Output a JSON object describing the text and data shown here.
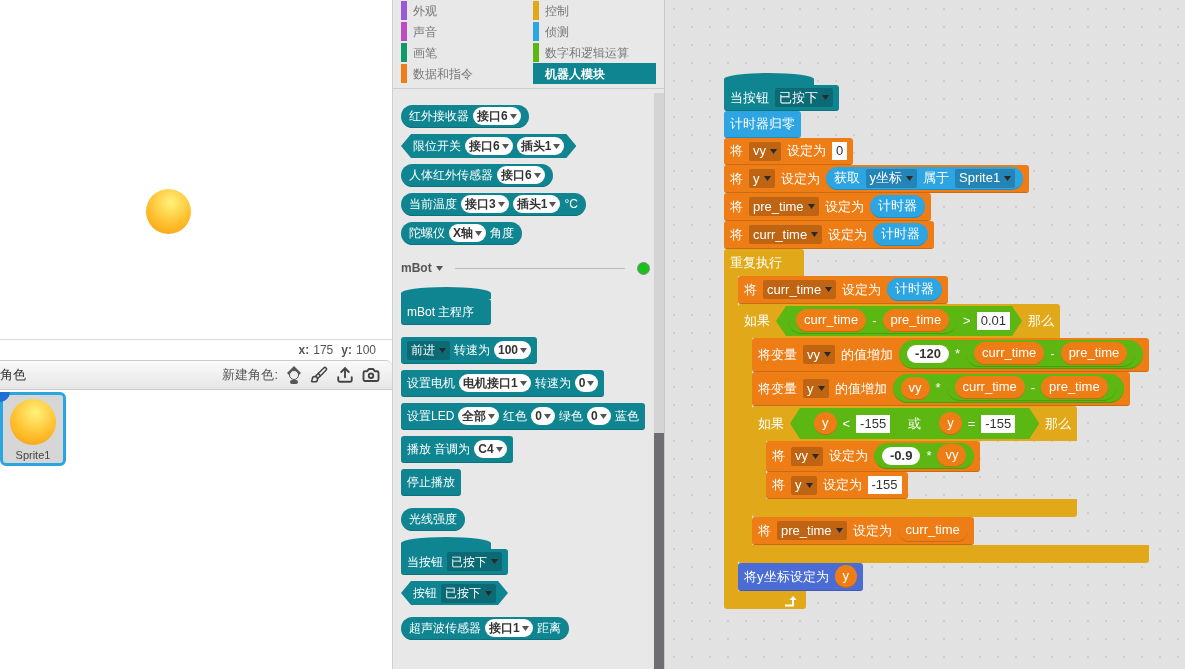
{
  "stage": {
    "x_label": "x:",
    "x_value": "175",
    "y_label": "y:",
    "y_value": "100"
  },
  "sprites": {
    "title": "角色",
    "new_label": "新建角色:",
    "items": [
      {
        "name": "Sprite1",
        "selected": true
      }
    ]
  },
  "palette": {
    "categories": [
      {
        "label": "外观",
        "color": "#9a5ad8",
        "selected": false
      },
      {
        "label": "控制",
        "color": "#e1a91a",
        "selected": false
      },
      {
        "label": "声音",
        "color": "#c04ac4",
        "selected": false
      },
      {
        "label": "侦测",
        "color": "#2ca5e2",
        "selected": false
      },
      {
        "label": "画笔",
        "color": "#0e9a6c",
        "selected": false
      },
      {
        "label": "数字和逻辑运算",
        "color": "#5cb712",
        "selected": false
      },
      {
        "label": "数据和指令",
        "color": "#ee7d16",
        "selected": false
      },
      {
        "label": "机器人模块",
        "color": "#0f8591",
        "selected": true
      }
    ],
    "blocks_top": [
      {
        "color": "#0f8591",
        "kind": "reporter",
        "parts": [
          {
            "kind": "label",
            "text": "红外接收器"
          },
          {
            "kind": "pill",
            "text": "接口6"
          }
        ]
      },
      {
        "color": "#0f8591",
        "kind": "boolean",
        "parts": [
          {
            "kind": "label",
            "text": "限位开关"
          },
          {
            "kind": "pill",
            "text": "接口6"
          },
          {
            "kind": "pill",
            "text": "插头1"
          }
        ]
      },
      {
        "color": "#0f8591",
        "kind": "reporter",
        "parts": [
          {
            "kind": "label",
            "text": "人体红外传感器"
          },
          {
            "kind": "pill",
            "text": "接口6"
          }
        ]
      },
      {
        "color": "#0f8591",
        "kind": "reporter",
        "parts": [
          {
            "kind": "label",
            "text": "当前温度"
          },
          {
            "kind": "pill",
            "text": "接口3"
          },
          {
            "kind": "pill",
            "text": "插头1"
          },
          {
            "kind": "label",
            "text": "°C"
          }
        ]
      },
      {
        "color": "#0f8591",
        "kind": "reporter",
        "parts": [
          {
            "kind": "label",
            "text": "陀螺仪"
          },
          {
            "kind": "pill",
            "text": "X轴"
          },
          {
            "kind": "label",
            "text": "角度"
          }
        ]
      }
    ],
    "section": {
      "title": "mBot",
      "connected": true
    },
    "groups": [
      [
        {
          "color": "#0f8591",
          "kind": "hat",
          "parts": [
            {
              "kind": "label",
              "text": "mBot 主程序"
            }
          ]
        }
      ],
      [
        {
          "color": "#0f8591",
          "kind": "stack",
          "parts": [
            {
              "kind": "menu",
              "text": "前进"
            },
            {
              "kind": "label",
              "text": "转速为"
            },
            {
              "kind": "pill",
              "text": "100"
            }
          ]
        },
        {
          "color": "#0f8591",
          "kind": "stack",
          "parts": [
            {
              "kind": "label",
              "text": "设置电机"
            },
            {
              "kind": "pill",
              "text": "电机接口1"
            },
            {
              "kind": "label",
              "text": "转速为"
            },
            {
              "kind": "pill",
              "text": "0"
            }
          ]
        },
        {
          "color": "#0f8591",
          "kind": "stack",
          "parts": [
            {
              "kind": "label",
              "text": "设置LED"
            },
            {
              "kind": "pill",
              "text": "全部"
            },
            {
              "kind": "label",
              "text": "红色"
            },
            {
              "kind": "pill",
              "text": "0"
            },
            {
              "kind": "label",
              "text": "绿色"
            },
            {
              "kind": "pill",
              "text": "0"
            },
            {
              "kind": "label",
              "text": "蓝色"
            }
          ]
        },
        {
          "color": "#0f8591",
          "kind": "stack",
          "parts": [
            {
              "kind": "label",
              "text": "播放 音调为"
            },
            {
              "kind": "pill",
              "text": "C4"
            }
          ]
        },
        {
          "color": "#0f8591",
          "kind": "stack",
          "parts": [
            {
              "kind": "label",
              "text": "停止播放"
            }
          ]
        }
      ],
      [
        {
          "color": "#0f8591",
          "kind": "reporter",
          "parts": [
            {
              "kind": "label",
              "text": "光线强度"
            }
          ]
        },
        {
          "color": "#0f8591",
          "kind": "hat",
          "parts": [
            {
              "kind": "label",
              "text": "当按钮"
            },
            {
              "kind": "menu",
              "text": "已按下"
            }
          ]
        },
        {
          "color": "#0f8591",
          "kind": "boolean",
          "parts": [
            {
              "kind": "label",
              "text": "按钮"
            },
            {
              "kind": "menu",
              "text": "已按下"
            }
          ]
        }
      ],
      [
        {
          "color": "#0f8591",
          "kind": "reporter",
          "parts": [
            {
              "kind": "label",
              "text": "超声波传感器"
            },
            {
              "kind": "pill",
              "text": "接口1"
            },
            {
              "kind": "label",
              "text": "距离"
            }
          ]
        }
      ]
    ]
  },
  "script": {
    "blocks": [
      {
        "color": "#0f8591",
        "kind": "hat",
        "parts": [
          {
            "kind": "label",
            "text": "当按钮"
          },
          {
            "kind": "menu",
            "text": "已按下"
          }
        ]
      },
      {
        "color": "#2ca5e2",
        "kind": "stack",
        "parts": [
          {
            "kind": "label",
            "text": "计时器归零"
          }
        ]
      },
      {
        "color": "#ee7d16",
        "kind": "stack",
        "parts": [
          {
            "kind": "label",
            "text": "将"
          },
          {
            "kind": "menu",
            "text": "vy"
          },
          {
            "kind": "label",
            "text": "设定为"
          },
          {
            "kind": "number",
            "text": "0"
          }
        ]
      },
      {
        "color": "#ee7d16",
        "kind": "stack",
        "parts": [
          {
            "kind": "label",
            "text": "将"
          },
          {
            "kind": "menu",
            "text": "y"
          },
          {
            "kind": "label",
            "text": "设定为"
          },
          {
            "kind": "block",
            "block": {
              "color": "#2ca5e2",
              "kind": "reporter",
              "parts": [
                {
                  "kind": "label",
                  "text": "获取"
                },
                {
                  "kind": "menu",
                  "text": "y坐标"
                },
                {
                  "kind": "label",
                  "text": "属于"
                },
                {
                  "kind": "menu",
                  "text": "Sprite1"
                }
              ]
            }
          }
        ]
      },
      {
        "color": "#ee7d16",
        "kind": "stack",
        "parts": [
          {
            "kind": "label",
            "text": "将"
          },
          {
            "kind": "menu",
            "text": "pre_time"
          },
          {
            "kind": "label",
            "text": "设定为"
          },
          {
            "kind": "block",
            "block": {
              "color": "#2ca5e2",
              "kind": "reporter",
              "parts": [
                {
                  "kind": "label",
                  "text": "计时器"
                }
              ]
            }
          }
        ]
      },
      {
        "color": "#ee7d16",
        "kind": "stack",
        "parts": [
          {
            "kind": "label",
            "text": "将"
          },
          {
            "kind": "menu",
            "text": "curr_time"
          },
          {
            "kind": "label",
            "text": "设定为"
          },
          {
            "kind": "block",
            "block": {
              "color": "#2ca5e2",
              "kind": "reporter",
              "parts": [
                {
                  "kind": "label",
                  "text": "计时器"
                }
              ]
            }
          }
        ]
      },
      {
        "color": "#e1a91a",
        "kind": "c",
        "loop": true,
        "parts": [
          {
            "kind": "label",
            "text": "重复执行"
          }
        ],
        "children": [
          {
            "color": "#ee7d16",
            "kind": "stack",
            "parts": [
              {
                "kind": "label",
                "text": "将"
              },
              {
                "kind": "menu",
                "text": "curr_time"
              },
              {
                "kind": "label",
                "text": "设定为"
              },
              {
                "kind": "block",
                "block": {
                  "color": "#2ca5e2",
                  "kind": "reporter",
                  "parts": [
                    {
                      "kind": "label",
                      "text": "计时器"
                    }
                  ]
                }
              }
            ]
          },
          {
            "color": "#e1a91a",
            "kind": "c",
            "loop": false,
            "parts": [
              {
                "kind": "label",
                "text": "如果"
              },
              {
                "kind": "block",
                "block": {
                  "color": "#5cb712",
                  "kind": "boolean",
                  "parts": [
                    {
                      "kind": "block",
                      "block": {
                        "color": "#5cb712",
                        "kind": "reporter",
                        "parts": [
                          {
                            "kind": "block",
                            "block": {
                              "color": "#ee7d16",
                              "kind": "reporter",
                              "parts": [
                                {
                                  "kind": "label",
                                  "text": "curr_time"
                                }
                              ]
                            }
                          },
                          {
                            "kind": "label",
                            "text": "-"
                          },
                          {
                            "kind": "block",
                            "block": {
                              "color": "#ee7d16",
                              "kind": "reporter",
                              "parts": [
                                {
                                  "kind": "label",
                                  "text": "pre_time"
                                }
                              ]
                            }
                          }
                        ]
                      }
                    },
                    {
                      "kind": "label",
                      "text": ">"
                    },
                    {
                      "kind": "number",
                      "text": "0.01"
                    }
                  ]
                }
              },
              {
                "kind": "label",
                "text": "那么"
              }
            ],
            "children": [
              {
                "color": "#ee7d16",
                "kind": "stack",
                "parts": [
                  {
                    "kind": "label",
                    "text": "将变量"
                  },
                  {
                    "kind": "menu",
                    "text": "vy"
                  },
                  {
                    "kind": "label",
                    "text": "的值增加"
                  },
                  {
                    "kind": "block",
                    "block": {
                      "color": "#5cb712",
                      "kind": "reporter",
                      "parts": [
                        {
                          "kind": "round",
                          "text": "-120"
                        },
                        {
                          "kind": "label",
                          "text": "*"
                        },
                        {
                          "kind": "block",
                          "block": {
                            "color": "#5cb712",
                            "kind": "reporter",
                            "parts": [
                              {
                                "kind": "block",
                                "block": {
                                  "color": "#ee7d16",
                                  "kind": "reporter",
                                  "parts": [
                                    {
                                      "kind": "label",
                                      "text": "curr_time"
                                    }
                                  ]
                                }
                              },
                              {
                                "kind": "label",
                                "text": "-"
                              },
                              {
                                "kind": "block",
                                "block": {
                                  "color": "#ee7d16",
                                  "kind": "reporter",
                                  "parts": [
                                    {
                                      "kind": "label",
                                      "text": "pre_time"
                                    }
                                  ]
                                }
                              }
                            ]
                          }
                        }
                      ]
                    }
                  }
                ]
              },
              {
                "color": "#ee7d16",
                "kind": "stack",
                "parts": [
                  {
                    "kind": "label",
                    "text": "将变量"
                  },
                  {
                    "kind": "menu",
                    "text": "y"
                  },
                  {
                    "kind": "label",
                    "text": "的值增加"
                  },
                  {
                    "kind": "block",
                    "block": {
                      "color": "#5cb712",
                      "kind": "reporter",
                      "parts": [
                        {
                          "kind": "block",
                          "block": {
                            "color": "#ee7d16",
                            "kind": "reporter",
                            "parts": [
                              {
                                "kind": "label",
                                "text": "vy"
                              }
                            ]
                          }
                        },
                        {
                          "kind": "label",
                          "text": "*"
                        },
                        {
                          "kind": "block",
                          "block": {
                            "color": "#5cb712",
                            "kind": "reporter",
                            "parts": [
                              {
                                "kind": "block",
                                "block": {
                                  "color": "#ee7d16",
                                  "kind": "reporter",
                                  "parts": [
                                    {
                                      "kind": "label",
                                      "text": "curr_time"
                                    }
                                  ]
                                }
                              },
                              {
                                "kind": "label",
                                "text": "-"
                              },
                              {
                                "kind": "block",
                                "block": {
                                  "color": "#ee7d16",
                                  "kind": "reporter",
                                  "parts": [
                                    {
                                      "kind": "label",
                                      "text": "pre_time"
                                    }
                                  ]
                                }
                              }
                            ]
                          }
                        }
                      ]
                    }
                  }
                ]
              },
              {
                "color": "#e1a91a",
                "kind": "c",
                "loop": false,
                "parts": [
                  {
                    "kind": "label",
                    "text": "如果"
                  },
                  {
                    "kind": "block",
                    "block": {
                      "color": "#5cb712",
                      "kind": "boolean",
                      "parts": [
                        {
                          "kind": "block",
                          "block": {
                            "color": "#5cb712",
                            "kind": "boolean",
                            "parts": [
                              {
                                "kind": "block",
                                "block": {
                                  "color": "#ee7d16",
                                  "kind": "reporter",
                                  "parts": [
                                    {
                                      "kind": "label",
                                      "text": "y"
                                    }
                                  ]
                                }
                              },
                              {
                                "kind": "label",
                                "text": "<"
                              },
                              {
                                "kind": "number",
                                "text": "-155"
                              }
                            ]
                          }
                        },
                        {
                          "kind": "label",
                          "text": "或"
                        },
                        {
                          "kind": "block",
                          "block": {
                            "color": "#5cb712",
                            "kind": "boolean",
                            "parts": [
                              {
                                "kind": "block",
                                "block": {
                                  "color": "#ee7d16",
                                  "kind": "reporter",
                                  "parts": [
                                    {
                                      "kind": "label",
                                      "text": "y"
                                    }
                                  ]
                                }
                              },
                              {
                                "kind": "label",
                                "text": "="
                              },
                              {
                                "kind": "number",
                                "text": "-155"
                              }
                            ]
                          }
                        }
                      ]
                    }
                  },
                  {
                    "kind": "label",
                    "text": "那么"
                  }
                ],
                "children": [
                  {
                    "color": "#ee7d16",
                    "kind": "stack",
                    "parts": [
                      {
                        "kind": "label",
                        "text": "将"
                      },
                      {
                        "kind": "menu",
                        "text": "vy"
                      },
                      {
                        "kind": "label",
                        "text": "设定为"
                      },
                      {
                        "kind": "block",
                        "block": {
                          "color": "#5cb712",
                          "kind": "reporter",
                          "parts": [
                            {
                              "kind": "round",
                              "text": "-0.9"
                            },
                            {
                              "kind": "label",
                              "text": "*"
                            },
                            {
                              "kind": "block",
                              "block": {
                                "color": "#ee7d16",
                                "kind": "reporter",
                                "parts": [
                                  {
                                    "kind": "label",
                                    "text": "vy"
                                  }
                                ]
                              }
                            }
                          ]
                        }
                      }
                    ]
                  },
                  {
                    "color": "#ee7d16",
                    "kind": "stack",
                    "parts": [
                      {
                        "kind": "label",
                        "text": "将"
                      },
                      {
                        "kind": "menu",
                        "text": "y"
                      },
                      {
                        "kind": "label",
                        "text": "设定为"
                      },
                      {
                        "kind": "number",
                        "text": "-155"
                      }
                    ]
                  }
                ]
              },
              {
                "color": "#ee7d16",
                "kind": "stack",
                "parts": [
                  {
                    "kind": "label",
                    "text": "将"
                  },
                  {
                    "kind": "menu",
                    "text": "pre_time"
                  },
                  {
                    "kind": "label",
                    "text": "设定为"
                  },
                  {
                    "kind": "block",
                    "block": {
                      "color": "#ee7d16",
                      "kind": "reporter",
                      "parts": [
                        {
                          "kind": "label",
                          "text": "curr_time"
                        }
                      ]
                    }
                  }
                ]
              }
            ]
          },
          {
            "color": "#4a6cd4",
            "kind": "stack",
            "parts": [
              {
                "kind": "label",
                "text": "将y坐标设定为"
              },
              {
                "kind": "block",
                "block": {
                  "color": "#ee7d16",
                  "kind": "reporter",
                  "parts": [
                    {
                      "kind": "label",
                      "text": "y"
                    }
                  ]
                }
              }
            ]
          }
        ]
      }
    ]
  }
}
